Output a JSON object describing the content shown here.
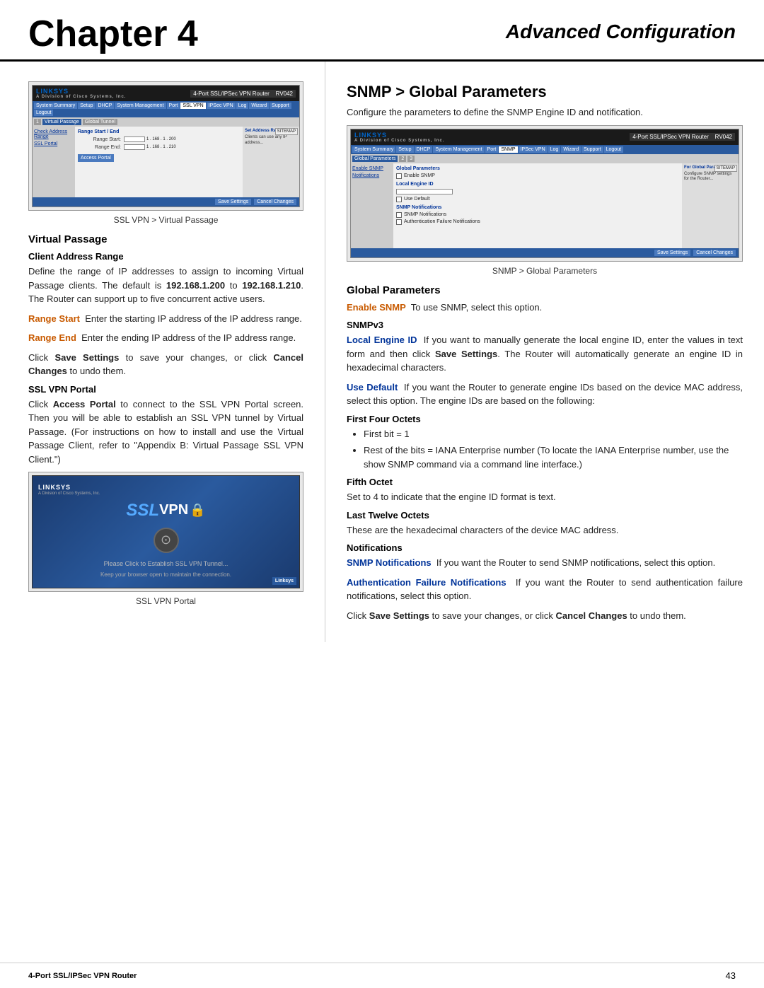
{
  "header": {
    "chapter": "Chapter 4",
    "section": "Advanced Configuration"
  },
  "footer": {
    "product": "4-Port SSL/IPSec VPN Router",
    "page": "43"
  },
  "left": {
    "screenshot1_caption": "SSL VPN > Virtual Passage",
    "virtual_passage": {
      "heading": "Virtual Passage",
      "client_address_range": {
        "heading": "Client Address Range",
        "body1": "Define the range of IP addresses to assign to incoming Virtual Passage clients. The default is 192.168.1.200 to 192.168.1.210. The Router can support up to five concurrent active users.",
        "range_start_label": "Range Start",
        "range_start_text": "Enter the starting IP address of the IP address range.",
        "range_end_label": "Range End",
        "range_end_text": "Enter the ending IP address of the IP address range.",
        "save_text": "Click Save Settings to save your changes, or click Cancel Changes to undo them."
      },
      "ssl_vpn_portal": {
        "heading": "SSL VPN Portal",
        "body": "Click Access Portal to connect to the SSL VPN Portal screen. Then you will be able to establish an SSL VPN tunnel by Virtual Passage. (For instructions on how to install and use the Virtual Passage Client, refer to \"Appendix B: Virtual Passage SSL VPN Client.\")"
      }
    },
    "screenshot2_caption": "SSL VPN Portal"
  },
  "right": {
    "main_heading": "SNMP > Global Parameters",
    "intro": "Configure the parameters to define the SNMP Engine ID and notification.",
    "screenshot_caption": "SNMP > Global Parameters",
    "global_parameters": {
      "heading": "Global Parameters",
      "enable_snmp_label": "Enable SNMP",
      "enable_snmp_text": "To use SNMP, select this option.",
      "snmpv3_heading": "SNMPv3",
      "local_engine_id": {
        "label": "Local Engine ID",
        "body": "If you want to manually generate the local engine ID, enter the values in text form and then click Save Settings. The Router will automatically generate an engine ID in hexadecimal characters."
      },
      "use_default": {
        "label": "Use Default",
        "body": "If you want the Router to generate engine IDs based on the device MAC address, select this option. The engine IDs are based on the following:"
      },
      "first_four_octets": {
        "heading": "First Four Octets",
        "items": [
          "First bit = 1",
          "Rest of the bits = IANA Enterprise number (To locate the IANA Enterprise number, use the show SNMP command via a command line interface.)"
        ]
      },
      "fifth_octet": {
        "heading": "Fifth Octet",
        "body": "Set to 4 to indicate that the engine ID format is text."
      },
      "last_twelve_octets": {
        "heading": "Last Twelve Octets",
        "body": "These are the hexadecimal characters of the device MAC address."
      },
      "notifications": {
        "heading": "Notifications",
        "snmp_notifications_label": "SNMP Notifications",
        "snmp_notifications_text": "If you want the Router to send SNMP notifications, select this option.",
        "auth_failure_label": "Authentication Failure Notifications",
        "auth_failure_text": "If you want the Router to send authentication failure notifications, select this option.",
        "save_text": "Click Save Settings to save your changes, or click Cancel Changes to undo them."
      }
    }
  }
}
